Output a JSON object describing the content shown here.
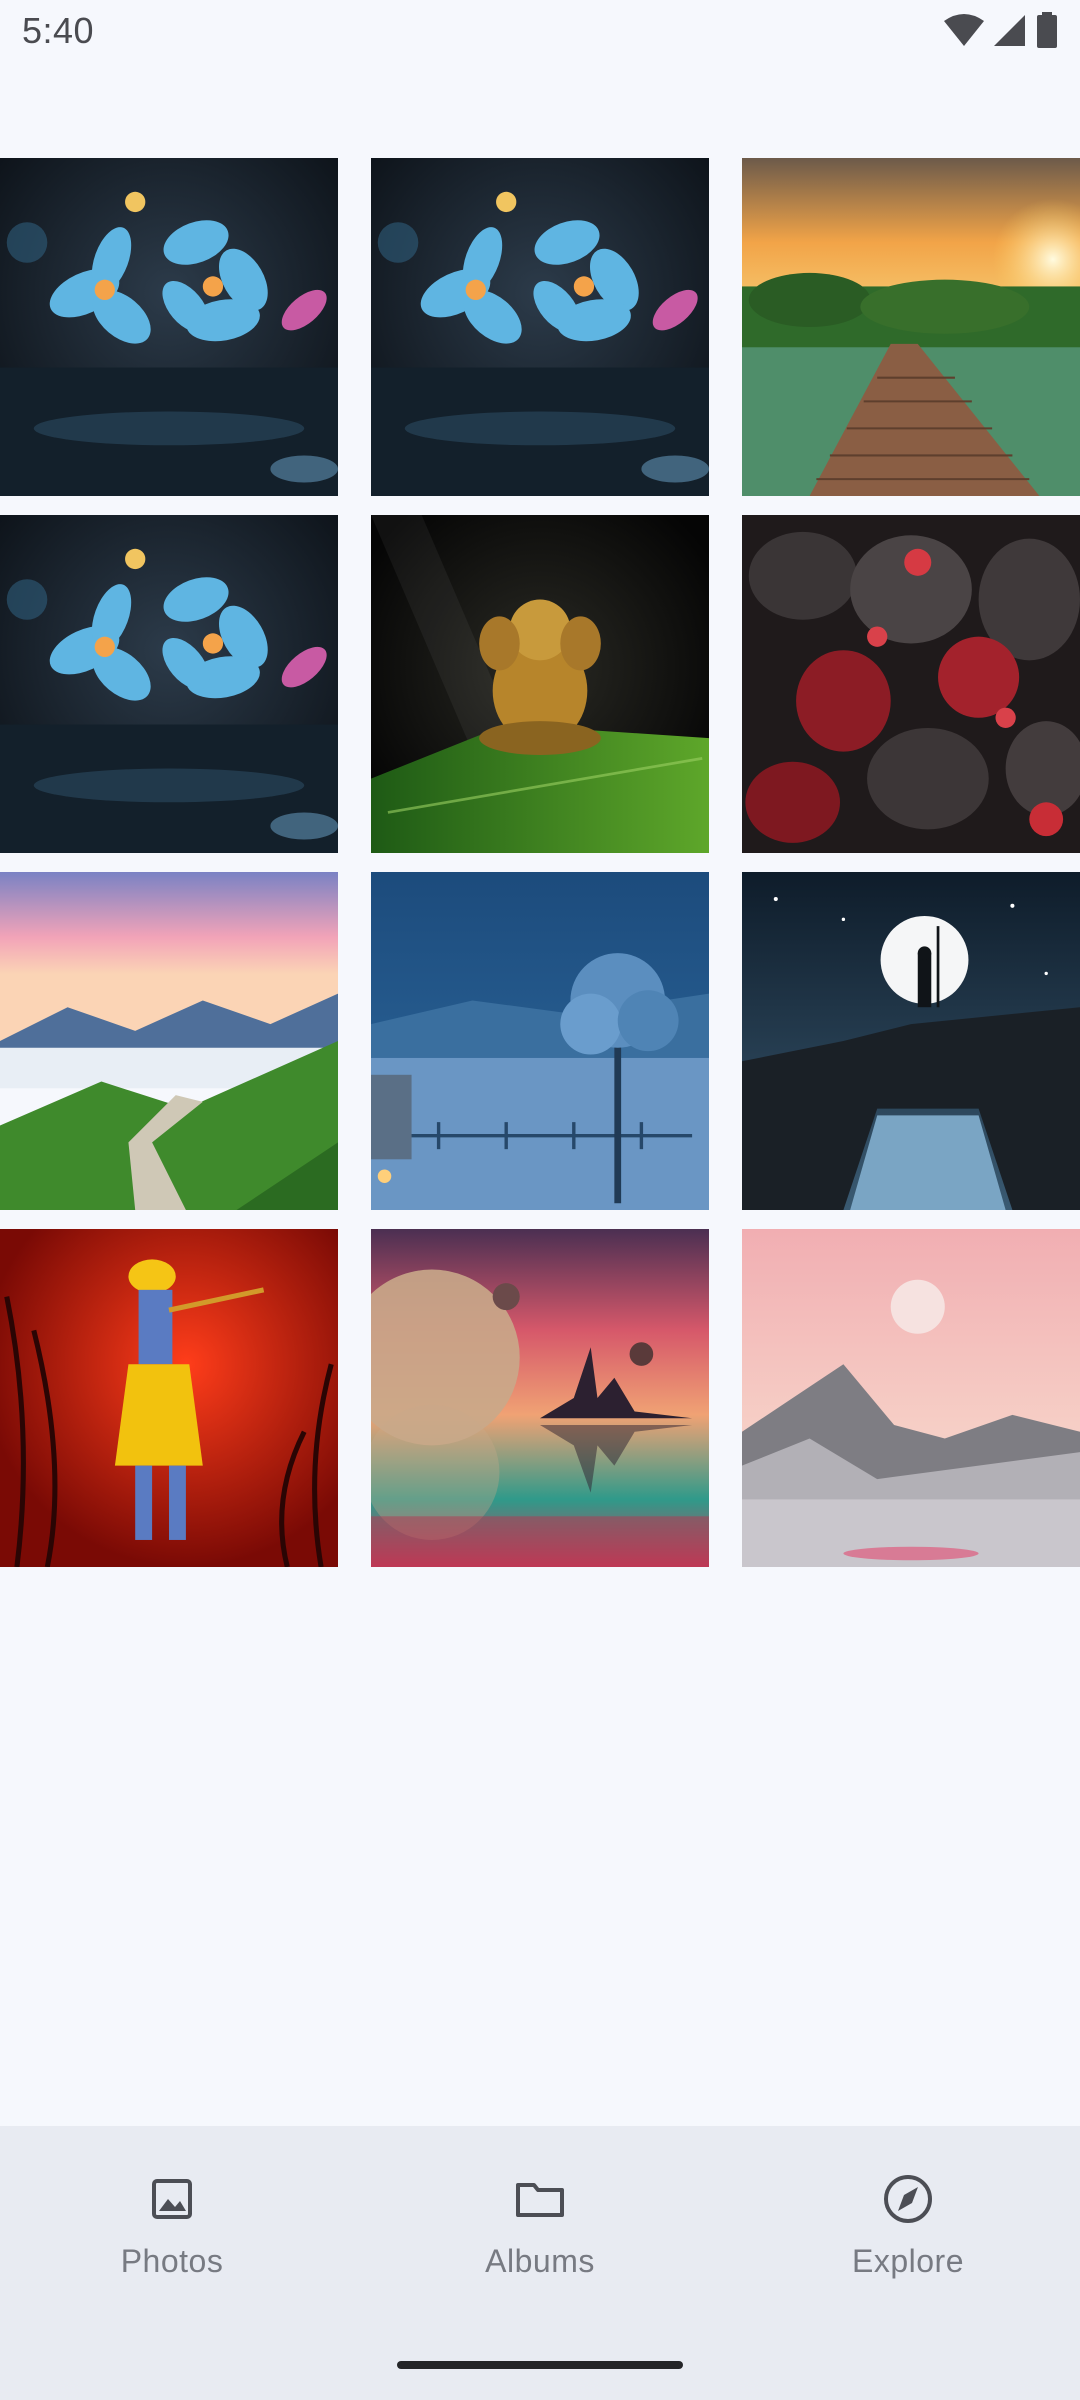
{
  "status_bar": {
    "time": "5:40"
  },
  "photos": [
    {
      "icon": "blue-flowers-image"
    },
    {
      "icon": "blue-flowers-image"
    },
    {
      "icon": "wooden-bridge-sunset-image"
    },
    {
      "icon": "blue-flowers-image"
    },
    {
      "icon": "golden-ganesha-leaf-image"
    },
    {
      "icon": "red-gem-stones-image"
    },
    {
      "icon": "mountain-sunrise-road-image"
    },
    {
      "icon": "blue-night-tree-lake-image"
    },
    {
      "icon": "moon-silhouette-cliff-image"
    },
    {
      "icon": "krishna-red-forest-image"
    },
    {
      "icon": "planet-lake-reflection-image"
    },
    {
      "icon": "pink-moon-mountains-image"
    }
  ],
  "bottom_nav": {
    "items": [
      {
        "label": "Photos",
        "icon": "image-icon"
      },
      {
        "label": "Albums",
        "icon": "folder-icon"
      },
      {
        "label": "Explore",
        "icon": "compass-icon"
      }
    ]
  }
}
